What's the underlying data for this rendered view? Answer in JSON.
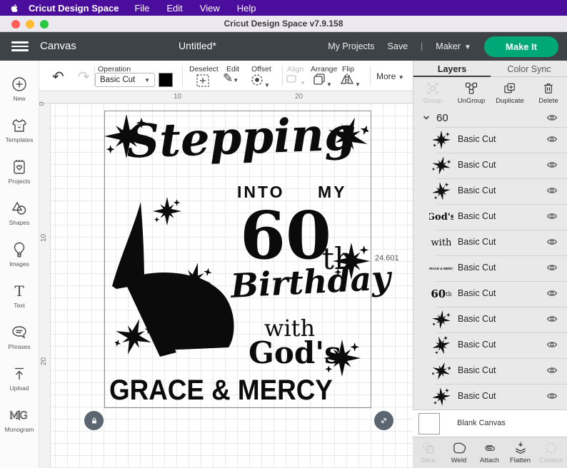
{
  "menu_bar": {
    "app_name": "Cricut Design Space",
    "items": [
      "File",
      "Edit",
      "View",
      "Help"
    ]
  },
  "title_bar": {
    "title": "Cricut Design Space  v7.9.158"
  },
  "header": {
    "canvas_label": "Canvas",
    "document_title": "Untitled*",
    "my_projects": "My Projects",
    "save": "Save",
    "divider": "|",
    "machine": "Maker",
    "make_it": "Make It"
  },
  "sidebar": {
    "items": [
      {
        "label": "New"
      },
      {
        "label": "Templates"
      },
      {
        "label": "Projects"
      },
      {
        "label": "Shapes"
      },
      {
        "label": "Images"
      },
      {
        "label": "Text"
      },
      {
        "label": "Phrases"
      },
      {
        "label": "Upload"
      },
      {
        "label": "Monogram"
      }
    ]
  },
  "toolbar": {
    "operation_label": "Operation",
    "operation_value": "Basic Cut",
    "deselect": "Deselect",
    "edit": "Edit",
    "offset": "Offset",
    "align": "Align",
    "arrange": "Arrange",
    "flip": "Flip",
    "more": "More"
  },
  "rulers": {
    "h": [
      "10",
      "20"
    ],
    "v": [
      "0",
      "10",
      "20"
    ]
  },
  "canvas": {
    "dimension_label": "24.601",
    "artwork": {
      "stepping": "Stepping",
      "into": "INTO",
      "my": "MY",
      "number": "60",
      "ordinal": "th",
      "birthday": "Birthday",
      "with": "with",
      "gods": "God's",
      "grace": "GRACE & MERCY"
    }
  },
  "layers_panel": {
    "tabs": [
      "Layers",
      "Color Sync"
    ],
    "actions": [
      "Group",
      "UnGroup",
      "Duplicate",
      "Delete"
    ],
    "group_name": "60",
    "layers": [
      {
        "label": "Basic Cut",
        "thumb": "star"
      },
      {
        "label": "Basic Cut",
        "thumb": "star"
      },
      {
        "label": "Basic Cut",
        "thumb": "star"
      },
      {
        "label": "Basic Cut",
        "thumb": "text",
        "thumb_text": "God's"
      },
      {
        "label": "Basic Cut",
        "thumb": "text",
        "thumb_text": "with"
      },
      {
        "label": "Basic Cut",
        "thumb": "text",
        "thumb_text": "GRACE & MERCY"
      },
      {
        "label": "Basic Cut",
        "thumb": "text60",
        "thumb_text": "60",
        "thumb_sub": "th"
      },
      {
        "label": "Basic Cut",
        "thumb": "star"
      },
      {
        "label": "Basic Cut",
        "thumb": "star"
      },
      {
        "label": "Basic Cut",
        "thumb": "star"
      },
      {
        "label": "Basic Cut",
        "thumb": "star"
      }
    ],
    "blank_canvas": "Blank Canvas",
    "bottom_actions": [
      "Slice",
      "Weld",
      "Attach",
      "Flatten",
      "Contour"
    ]
  }
}
